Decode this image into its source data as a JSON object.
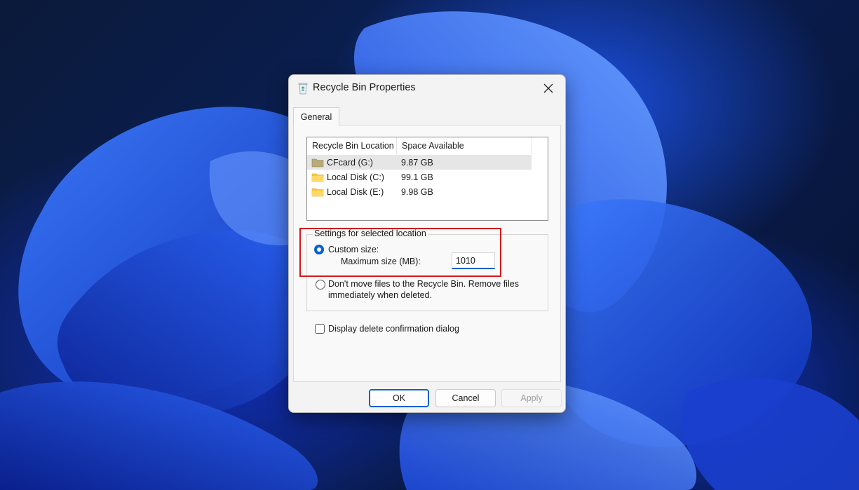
{
  "window": {
    "title": "Recycle Bin Properties",
    "close_icon": "close-icon",
    "app_icon": "recycle-bin-icon"
  },
  "tabs": [
    {
      "label": "General"
    }
  ],
  "locations": {
    "columns": [
      "Recycle Bin Location",
      "Space Available"
    ],
    "rows": [
      {
        "name": "CFcard (G:)",
        "space": "9.87 GB",
        "selected": true
      },
      {
        "name": "Local Disk (C:)",
        "space": "99.1 GB",
        "selected": false
      },
      {
        "name": "Local Disk (E:)",
        "space": "9.98 GB",
        "selected": false
      }
    ]
  },
  "settings": {
    "legend": "Settings for selected location",
    "custom_size_label": "Custom size:",
    "max_size_label": "Maximum size (MB):",
    "max_size_value": "1010",
    "dont_move_label_line1": "Don't move files to the Recycle Bin. Remove files",
    "dont_move_label_line2": "immediately when deleted.",
    "selected_option": "custom_size"
  },
  "confirm_dialog": {
    "label": "Display delete confirmation dialog",
    "checked": false
  },
  "buttons": {
    "ok": "OK",
    "cancel": "Cancel",
    "apply": "Apply"
  },
  "colors": {
    "accent": "#0a5fd0",
    "highlight": "#d11a1a"
  }
}
